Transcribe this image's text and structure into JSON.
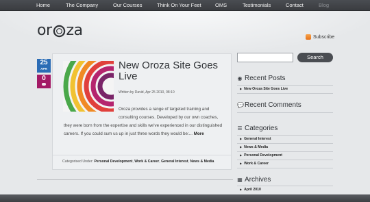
{
  "nav": {
    "items": [
      "Home",
      "The Company",
      "Our Courses",
      "Think On Your Feet",
      "OMS",
      "Testimonials",
      "Contact",
      "Blog"
    ]
  },
  "header": {
    "logo_text_left": "or",
    "logo_text_right": "za",
    "subscribe_label": "Subscribe"
  },
  "post": {
    "date_day": "25",
    "date_month": "APR",
    "comment_count": "0",
    "title": "New Oroza Site Goes Live",
    "meta": "Written by David, Apr 25 2010, 08:10",
    "excerpt_line1": "Oroza provides a range of targeted training and",
    "excerpt_line2": "consulting courses. Developed by our own coaches,",
    "excerpt_rest": "they were born from the expertise and skills we've experienced in our distinguished careers. If you could sum us up in just three words they would be:...",
    "more_label": "More",
    "categorised_label": "Categorised Under:",
    "categories": [
      "Personal Development",
      "Work & Career",
      "General Interest",
      "News & Media"
    ]
  },
  "sidebar": {
    "search_button": "Search",
    "recent_posts_title": "Recent Posts",
    "recent_posts": [
      "New Oroza Site Goes Live"
    ],
    "recent_comments_title": "Recent Comments",
    "categories_title": "Categories",
    "categories": [
      "General Interest",
      "News & Media",
      "Personal Development",
      "Work & Career"
    ],
    "archives_title": "Archives",
    "archives": [
      "April 2010"
    ]
  },
  "colors": {
    "date_badge": "#2b6cb5",
    "comment_badge": "#a31a66",
    "nav_bar": "#3f4246"
  }
}
